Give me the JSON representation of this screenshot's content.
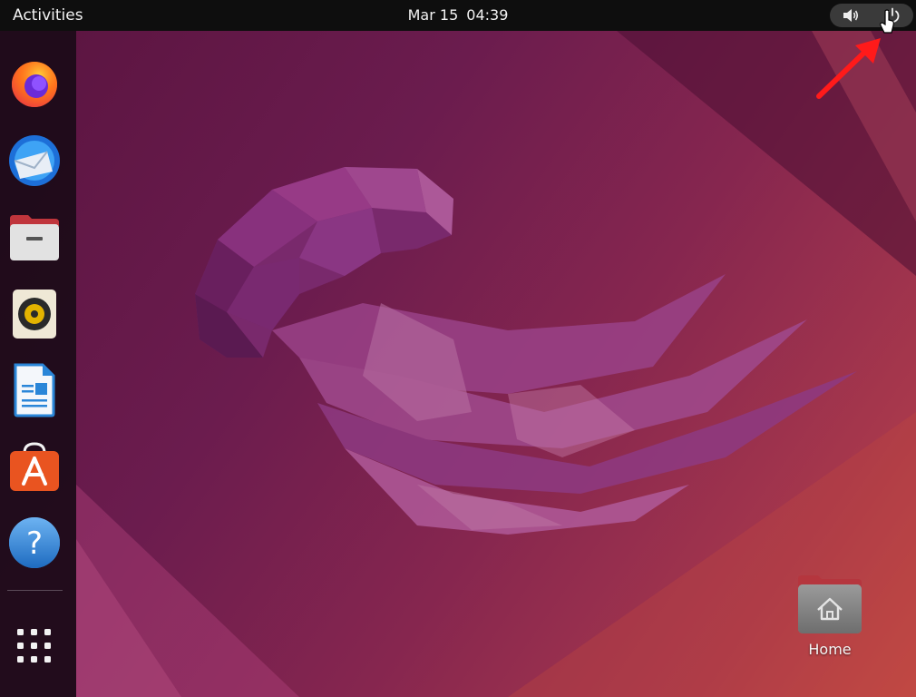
{
  "topbar": {
    "activities_label": "Activities",
    "date": "Mar 15",
    "time": "04:39",
    "tray": [
      {
        "icon": "speaker-icon"
      },
      {
        "icon": "power-icon"
      }
    ]
  },
  "dock": {
    "items": [
      {
        "name": "Firefox",
        "icon": "firefox-icon"
      },
      {
        "name": "Thunderbird",
        "icon": "thunderbird-icon"
      },
      {
        "name": "Files",
        "icon": "files-icon"
      },
      {
        "name": "Rhythmbox",
        "icon": "rhythmbox-icon"
      },
      {
        "name": "LibreOffice Writer",
        "icon": "writer-icon"
      },
      {
        "name": "Ubuntu Software",
        "icon": "software-icon"
      },
      {
        "name": "Help",
        "icon": "help-icon"
      }
    ],
    "apps_grid_icon": "app-grid-icon"
  },
  "desktop": {
    "icons": [
      {
        "label": "Home",
        "icon": "home-folder-icon"
      }
    ]
  },
  "colors": {
    "topbar": "#0e0e0e",
    "accent_orange": "#e95420",
    "annotation_arrow": "#ff1a1a"
  }
}
